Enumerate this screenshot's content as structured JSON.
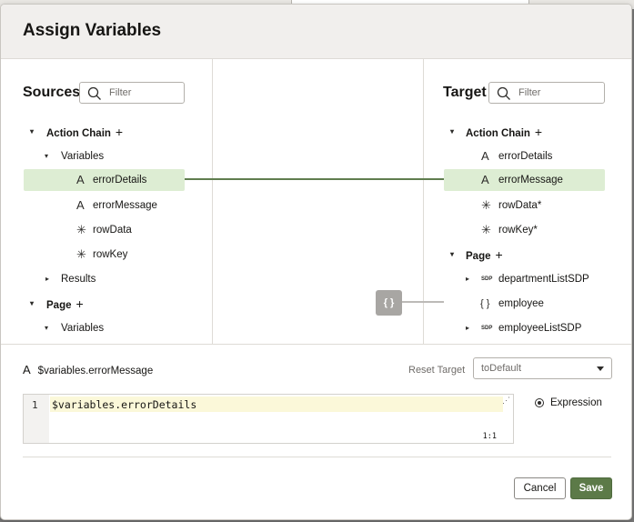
{
  "dialog": {
    "title": "Assign Variables"
  },
  "sources": {
    "title": "Sources",
    "filter_placeholder": "Filter",
    "tree": [
      {
        "label": "Action Chain",
        "icon": "",
        "caret": "▾",
        "plus": "+"
      },
      {
        "label": "Variables",
        "icon": "",
        "caret": "▾"
      },
      {
        "label": "errorDetails",
        "icon": "string-icon",
        "glyph": "A",
        "selected": true
      },
      {
        "label": "errorMessage",
        "icon": "string-icon",
        "glyph": "A"
      },
      {
        "label": "rowData",
        "icon": "any-type-icon",
        "glyph": "✳"
      },
      {
        "label": "rowKey",
        "icon": "any-type-icon",
        "glyph": "✳"
      },
      {
        "label": "Results",
        "icon": "",
        "caret": "▸"
      },
      {
        "label": "Page",
        "icon": "",
        "caret": "▾",
        "plus": "+"
      },
      {
        "label": "Variables",
        "icon": "",
        "caret": "▾"
      }
    ]
  },
  "target": {
    "title": "Target",
    "filter_placeholder": "Filter",
    "tree": [
      {
        "label": "Action Chain",
        "caret": "▾",
        "plus": "+"
      },
      {
        "label": "errorDetails",
        "icon": "string-icon",
        "glyph": "A"
      },
      {
        "label": "errorMessage",
        "icon": "string-icon",
        "glyph": "A",
        "selected": true
      },
      {
        "label": "rowData*",
        "icon": "any-type-icon",
        "glyph": "✳"
      },
      {
        "label": "rowKey*",
        "icon": "any-type-icon",
        "glyph": "✳"
      },
      {
        "label": "Page",
        "caret": "▾",
        "plus": "+"
      },
      {
        "label": "departmentListSDP",
        "icon": "sdp-icon",
        "glyph": "SDP",
        "caret": "▸"
      },
      {
        "label": "employee",
        "icon": "object-icon",
        "glyph": "{ }"
      },
      {
        "label": "employeeListSDP",
        "icon": "sdp-icon",
        "glyph": "SDP",
        "caret": "▸"
      }
    ]
  },
  "mapping": {
    "object_button": "{ }"
  },
  "expression": {
    "target_icon_glyph": "A",
    "target_path": "$variables.errorMessage",
    "reset_label": "Reset Target",
    "reset_value": "toDefault",
    "line_number": "1",
    "code": "$variables.errorDetails",
    "expand_glyph": "⋰",
    "cursor_position": "1:1",
    "mode_label": "Expression"
  },
  "footer": {
    "cancel_label": "Cancel",
    "save_label": "Save"
  },
  "colors": {
    "accent": "#5c7a48",
    "selected_row": "#ddedd3",
    "map_line": "#5f7d4f"
  }
}
